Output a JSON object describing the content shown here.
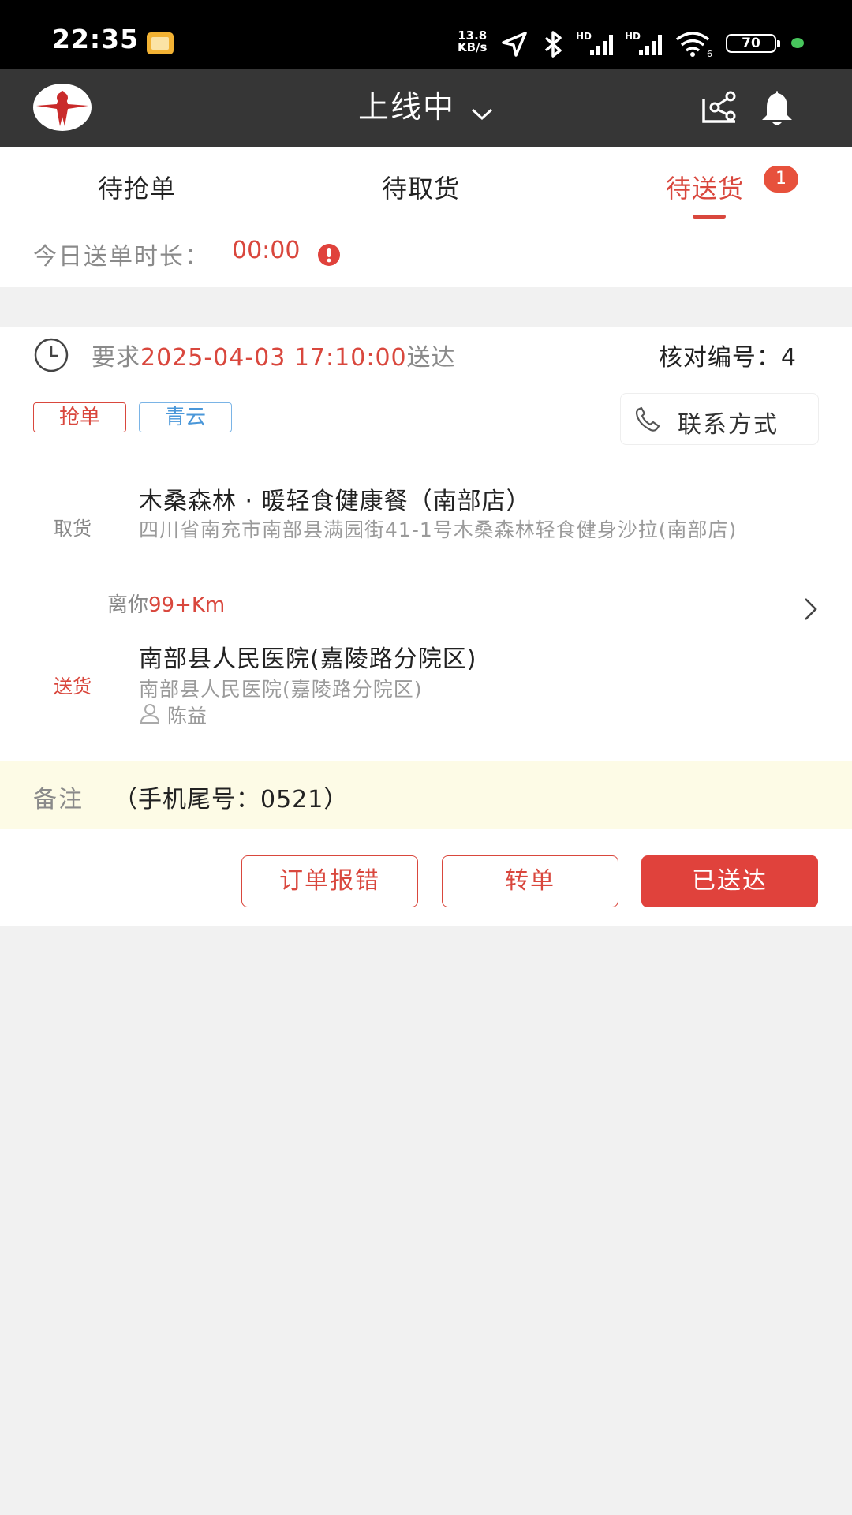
{
  "status_bar": {
    "time": "22:35",
    "net_speed_value": "13.8",
    "net_speed_unit": "KB/s",
    "battery": "70",
    "icons": [
      "gallery-notification-icon",
      "location-arrow-icon",
      "bluetooth-icon",
      "hd-signal-icon",
      "hd-signal-icon",
      "wifi-icon",
      "battery-icon"
    ]
  },
  "header": {
    "title": "上线中",
    "icons": [
      "logo",
      "chevron-down-icon",
      "share-icon",
      "bell-icon"
    ]
  },
  "tabs": [
    {
      "label": "待抢单",
      "active": false
    },
    {
      "label": "待取货",
      "active": false
    },
    {
      "label": "待送货",
      "active": true,
      "badge": "1"
    }
  ],
  "duration": {
    "label": "今日送单时长：",
    "value": "00:00"
  },
  "order": {
    "require_prefix": "要求",
    "require_time": "2025-04-03 17:10:00",
    "require_suffix": "送达",
    "check_no_label": "核对编号：",
    "check_no": "4",
    "tags": [
      "抢单",
      "青云"
    ],
    "contact_label": "联系方式",
    "pickup": {
      "label": "取货",
      "name": "木桑森林 · 暖轻食健康餐（南部店）",
      "address": "四川省南充市南部县满园街41-1号木桑森林轻食健身沙拉(南部店)"
    },
    "distance_prefix": "离你",
    "distance_value": "99+Km",
    "deliver": {
      "label": "送货",
      "name": "南部县人民医院(嘉陵路分院区)",
      "address": "南部县人民医院(嘉陵路分院区)",
      "person": "陈益"
    },
    "remark_label": "备注",
    "remark_text": "（手机尾号：0521）",
    "buttons": {
      "report": "订单报错",
      "transfer": "转单",
      "delivered": "已送达"
    }
  },
  "colors": {
    "accent": "#d9473d",
    "header_bg": "#363636",
    "remark_bg": "#fdfbe6",
    "tag_blue": "#4a97d9"
  }
}
